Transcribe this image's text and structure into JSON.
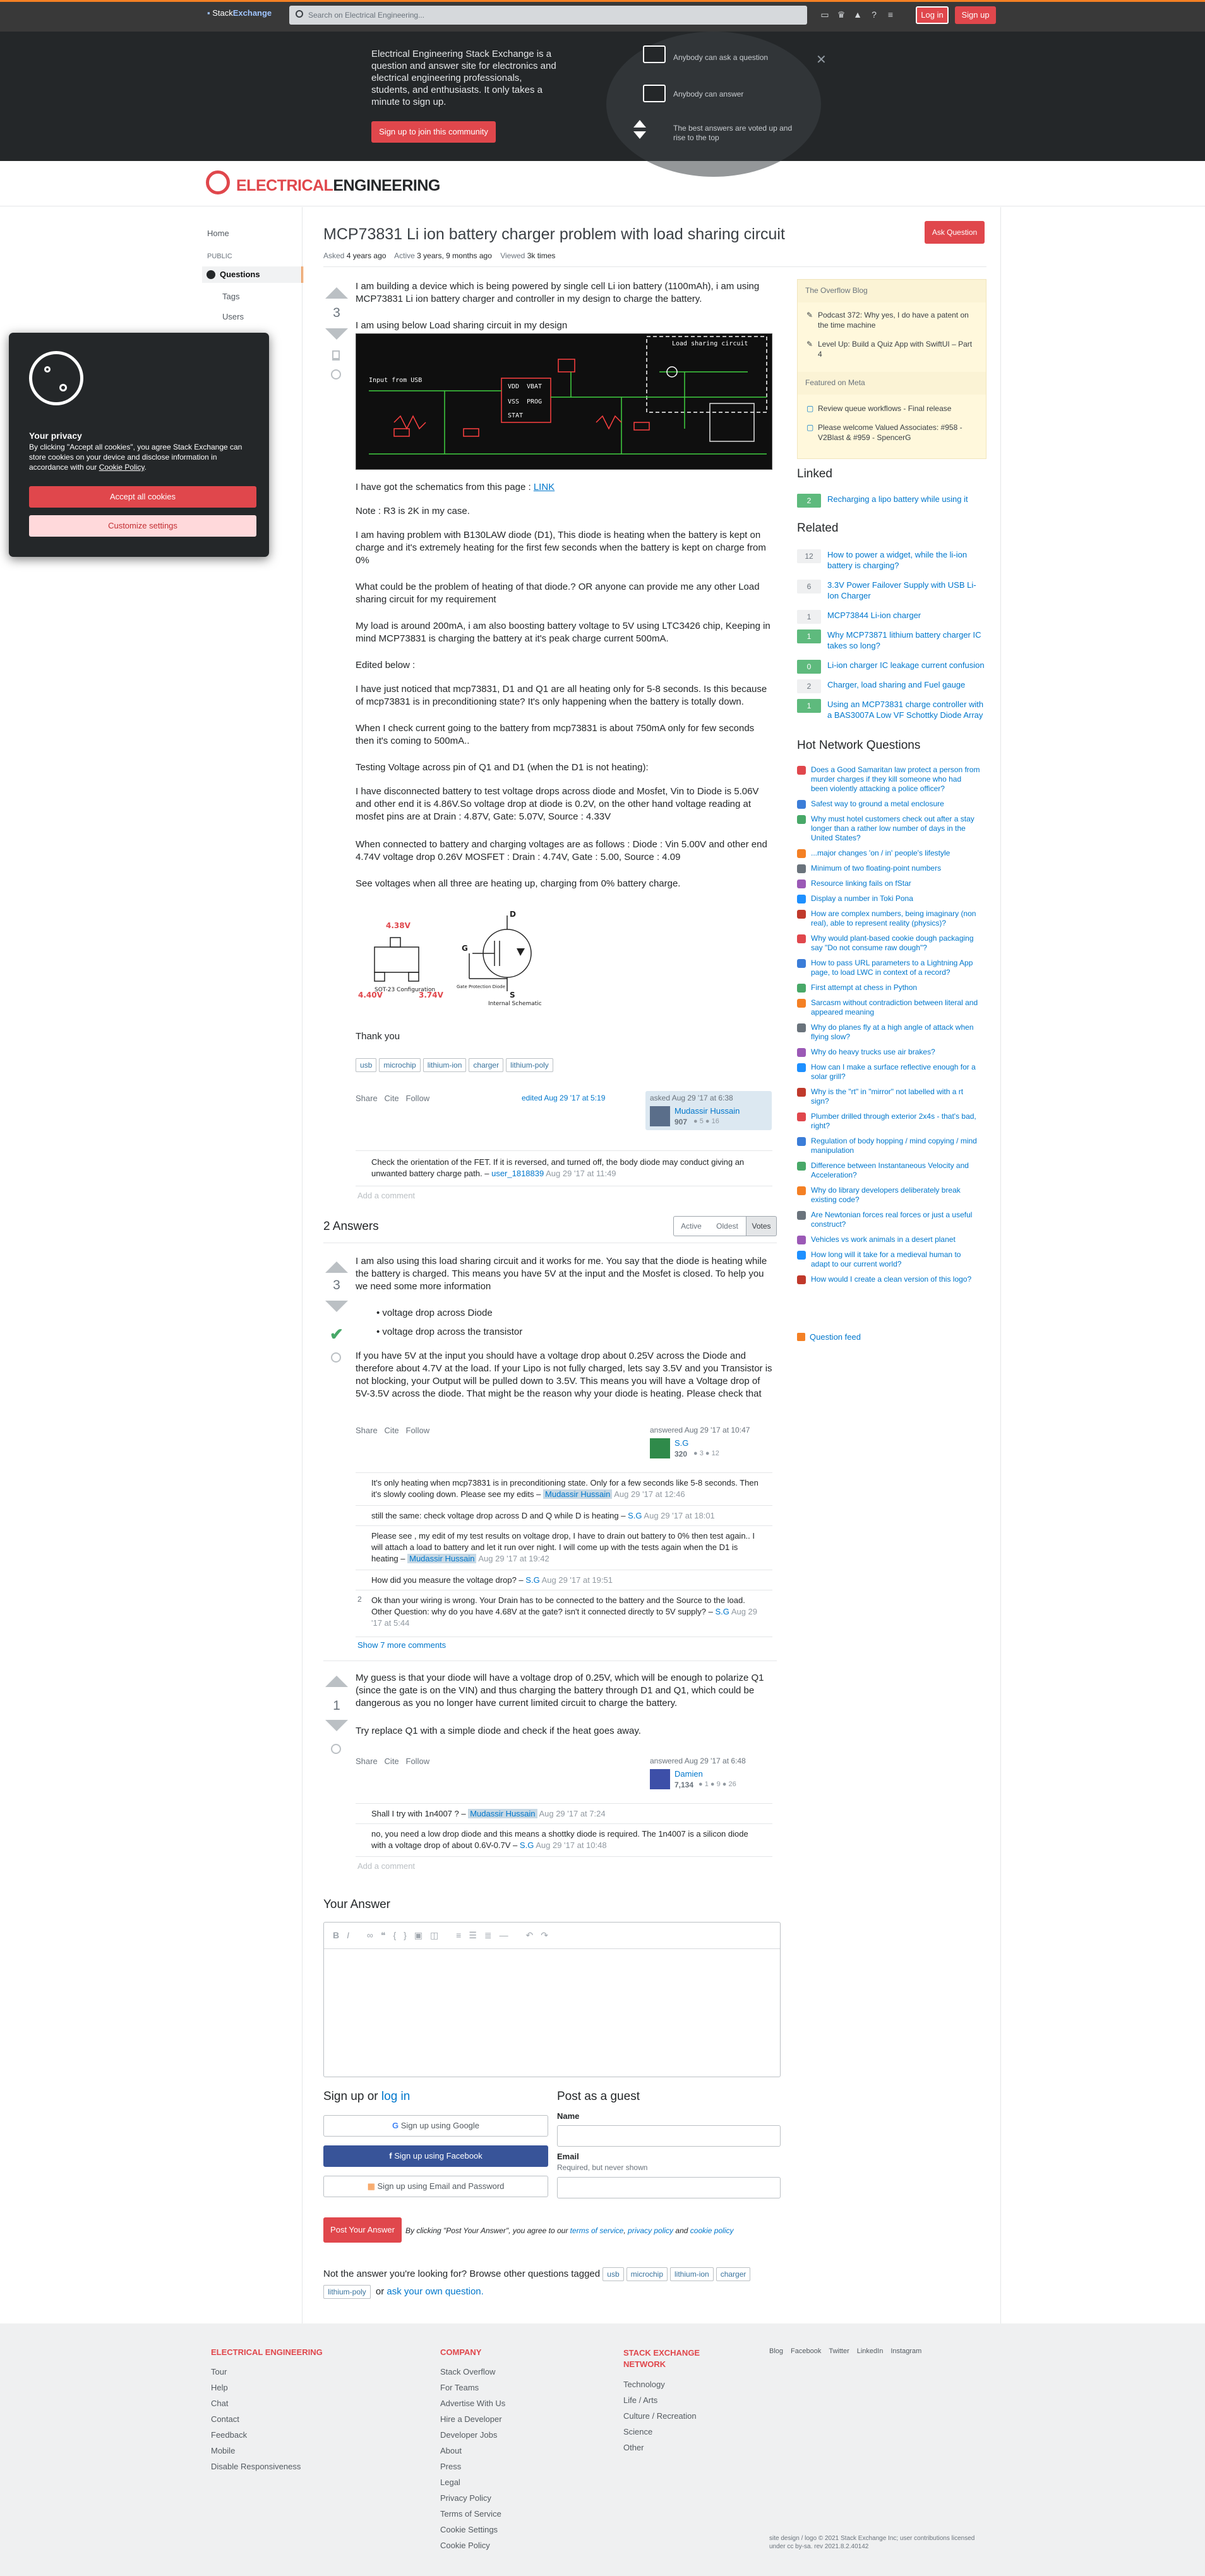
{
  "topbar": {
    "brand_a": "Stack",
    "brand_b": "Exchange",
    "search_placeholder": "Search on Electrical Engineering...",
    "login": "Log in",
    "signup": "Sign up"
  },
  "hero": {
    "text": "Electrical Engineering Stack Exchange is a question and answer site for electronics and electrical engineering professionals, students, and enthusiasts. It only takes a minute to sign up.",
    "cta": "Sign up to join this community",
    "features": [
      "Anybody can ask a question",
      "Anybody can answer",
      "The best answers are voted up and rise to the top"
    ]
  },
  "site": {
    "logo_a": "ELECTRICAL",
    "logo_b": "ENGINEERING"
  },
  "nav": {
    "home": "Home",
    "public": "PUBLIC",
    "questions": "Questions",
    "tags": "Tags",
    "users": "Users"
  },
  "question": {
    "title": "MCP73831 Li ion battery charger problem with load sharing circuit",
    "ask_button": "Ask Question",
    "asked_label": "Asked",
    "asked": "4 years ago",
    "active_label": "Active",
    "active": "3 years, 9 months ago",
    "viewed_label": "Viewed",
    "viewed": "3k times",
    "votes": "3",
    "p1": "I am building a device which is being powered by single cell Li ion battery (1100mAh), i am using MCP73831 Li ion battery charger and controller in my design to charge the battery.",
    "p2": "I am using below Load sharing circuit in my design",
    "p3a": "I have got the schematics from this page : ",
    "p3link": "LINK",
    "p4": "Note : R3 is 2K in my case.",
    "p5": "I am having problem with B130LAW diode (D1), This diode is heating when the battery is kept on charge and it's extremely heating for the first few seconds when the battery is kept on charge from 0%",
    "p6": "What could be the problem of heating of that diode.? OR anyone can provide me any other Load sharing circuit for my requirement",
    "p7": "My load is around 200mA, i am also boosting battery voltage to 5V using LTC3426 chip, Keeping in mind MCP73831 is charging the battery at it's peak charge current 500mA.",
    "p8": "Edited below :",
    "p9": "I have just noticed that mcp73831, D1 and Q1 are all heating only for 5-8 seconds. Is this because of mcp73831 is in preconditioning state? It's only happening when the battery is totally down.",
    "p10": "When I check current going to the battery from mcp73831 is about 750mA only for few seconds then it's coming to 500mA..",
    "p11": "Testing Voltage across pin of Q1 and D1 (when the D1 is not heating):",
    "p12": "I have disconnected battery to test voltage drops across diode and Mosfet, Vin to Diode is 5.06V and other end it is 4.86V.So voltage drop at diode is 0.2V, on the other hand voltage reading at mosfet pins are at Drain : 4.87V, Gate: 5.07V, Source : 4.33V",
    "p13": "When connected to battery and charging voltages are as follows : Diode : Vin 5.00V and other end 4.74V voltage drop 0.26V MOSFET : Drain : 4.74V, Gate : 5.00, Source : 4.09",
    "p14": "See voltages when all three are heating up, charging from 0% battery charge.",
    "p15": "Thank you",
    "tags": [
      "usb",
      "microchip",
      "lithium-ion",
      "charger",
      "lithium-poly"
    ],
    "share": "Share",
    "cite": "Cite",
    "follow": "Follow",
    "edited": "edited Aug 29 '17 at 5:19",
    "asked_full": "asked Aug 29 '17 at 6:38",
    "author": "Mudassir Hussain",
    "author_rep": "907",
    "author_badges": "● 5 ● 16",
    "comment": "Check the orientation of the FET. If it is reversed, and turned off, the body diode may conduct giving an unwanted battery charge path.",
    "comment_user": "user_1818839",
    "comment_date": "Aug 29 '17 at 11:49",
    "add_comment": "Add a comment"
  },
  "schematic": {
    "title": "Load sharing circuit",
    "input": "Input from USB",
    "pins": [
      "VDD",
      "VBAT",
      "VSS",
      "PROG",
      "STAT"
    ],
    "labels": [
      "D",
      "G",
      "S"
    ],
    "fet_labels": [
      "4.38V",
      "4.40V",
      "3.74V",
      "SOT-23 Configuration",
      "Internal Schematic",
      "Gate Protection Diode"
    ]
  },
  "answers": {
    "heading": "2 Answers",
    "sort": [
      "Active",
      "Oldest",
      "Votes"
    ],
    "a1": {
      "votes": "3",
      "p1": "I am also using this load sharing circuit and it works for me. You say that the diode is heating while the battery is charged. This means you have 5V at the input and the Mosfet is closed. To help you we need some more information",
      "bullets": [
        "voltage drop across Diode",
        "voltage drop across the transistor"
      ],
      "p2": "If you have 5V at the input you should have a voltage drop about 0.25V across the Diode and therefore about 4.7V at the load. If your Lipo is not fully charged, lets say 3.5V and you Transistor is not blocking, your Output will be pulled down to 3.5V. This means you will have a Voltage drop of 5V-3.5V across the diode. That might be the reason why your diode is heating. Please check that",
      "answered": "answered Aug 29 '17 at 10:47",
      "author": "S.G",
      "rep": "320",
      "badges": "● 3 ● 12",
      "comments": [
        {
          "text": "It's only heating when mcp73831 is in preconditioning state. Only for a few seconds like 5-8 seconds. Then it's slowly cooling down. Please see my edits –",
          "user": "Mudassir Hussain",
          "date": "Aug 29 '17 at 12:46"
        },
        {
          "text": "still the same: check voltage drop across D and Q while D is heating –",
          "user": "S.G",
          "date": "Aug 29 '17 at 18:01"
        },
        {
          "text": "Please see , my edit of my test results on voltage drop, I have to drain out battery to 0% then test again.. I will attach a load to battery and let it run over night. I will come up with the tests again when the D1 is heating –",
          "user": "Mudassir Hussain",
          "date": "Aug 29 '17 at 19:42"
        },
        {
          "text": "How did you measure the voltage drop? –",
          "user": "S.G",
          "date": "Aug 29 '17 at 19:51"
        },
        {
          "text": "Ok than your wiring is wrong. Your Drain has to be connected to the battery and the Source to the load. Other Question: why do you have 4.68V at the gate? isn't it connected directly to 5V supply? –",
          "user": "S.G",
          "date": "Aug 29 '17 at 5:44",
          "votes": "2"
        }
      ],
      "show_more": "Show 7 more comments"
    },
    "a2": {
      "votes": "1",
      "p1": "My guess is that your diode will have a voltage drop of 0.25V, which will be enough to polarize Q1 (since the gate is on the VIN) and thus charging the battery through D1 and Q1, which could be dangerous as you no longer have current limited circuit to charge the battery.",
      "p2": "Try replace Q1 with a simple diode and check if the heat goes away.",
      "answered": "answered Aug 29 '17 at 6:48",
      "author": "Damien",
      "rep": "7,134",
      "badges": "● 1 ● 9 ● 26",
      "comments": [
        {
          "text": "Shall I try with 1n4007 ? –",
          "user": "Mudassir Hussain",
          "date": "Aug 29 '17 at 7:24"
        },
        {
          "text": "no, you need a low drop diode and this means a shottky diode is required. The 1n4007 is a silicon diode with a voltage drop of about 0.6V-0.7V –",
          "user": "S.G",
          "date": "Aug 29 '17 at 10:48"
        }
      ],
      "add_comment": "Add a comment"
    }
  },
  "your_answer": {
    "heading": "Your Answer",
    "signup_heading": "Sign up or",
    "login_link": "log in",
    "google": "Sign up using Google",
    "facebook": "Sign up using Facebook",
    "email": "Sign up using Email and Password",
    "guest_heading": "Post as a guest",
    "name_label": "Name",
    "email_label": "Email",
    "email_hint": "Required, but never shown",
    "post_button": "Post Your Answer",
    "terms_prefix": "By clicking \"Post Your Answer\", you agree to our",
    "terms": "terms of service",
    "privacy": "privacy policy",
    "and": "and",
    "cookie": "cookie policy",
    "not_answer": "Not the answer you're looking for? Browse other questions tagged",
    "or": "or",
    "ask_own": "ask your own question."
  },
  "sidebar": {
    "blog_heading": "The Overflow Blog",
    "blog": [
      "Podcast 372: Why yes, I do have a patent on the time machine",
      "Level Up: Build a Quiz App with SwiftUI – Part 4"
    ],
    "meta_heading": "Featured on Meta",
    "meta": [
      "Review queue workflows - Final release",
      "Please welcome Valued Associates: #958 - V2Blast & #959 - SpencerG"
    ],
    "linked_heading": "Linked",
    "linked": [
      {
        "n": "2",
        "t": "Recharging a lipo battery while using it",
        "g": true
      }
    ],
    "related_heading": "Related",
    "related": [
      {
        "n": "12",
        "t": "How to power a widget, while the li-ion battery is charging?",
        "g": false
      },
      {
        "n": "6",
        "t": "3.3V Power Failover Supply with USB Li-Ion Charger",
        "g": false
      },
      {
        "n": "1",
        "t": "MCP73844 Li-ion charger",
        "g": false
      },
      {
        "n": "1",
        "t": "Why MCP73871 lithium battery charger IC takes so long?",
        "g": true
      },
      {
        "n": "0",
        "t": "Li-ion charger IC leakage current confusion",
        "g": true
      },
      {
        "n": "2",
        "t": "Charger, load sharing and Fuel gauge",
        "g": false
      },
      {
        "n": "1",
        "t": "Using an MCP73831 charge controller with a BAS3007A Low VF Schottky Diode Array",
        "g": true
      }
    ],
    "hnq_heading": "Hot Network Questions",
    "hnq": [
      "Does a Good Samaritan law protect a person from murder charges if they kill someone who had been violently attacking a police officer?",
      "Safest way to ground a metal enclosure",
      "Why must hotel customers check out after a stay longer than a rather low number of days in the United States?",
      "...major changes 'on / in' people's lifestyle",
      "Minimum of two floating-point numbers",
      "Resource linking fails on fStar",
      "Display a number in Toki Pona",
      "How are complex numbers, being imaginary (non real), able to represent reality (physics)?",
      "Why would plant-based cookie dough packaging say \"Do not consume raw dough\"?",
      "How to pass URL parameters to a Lightning App page, to load LWC in context of a record?",
      "First attempt at chess in Python",
      "Sarcasm without contradiction between literal and appeared meaning",
      "Why do planes fly at a high angle of attack when flying slow?",
      "Why do heavy trucks use air brakes?",
      "How can I make a surface reflective enough for a solar grill?",
      "Why is the \"rt\" in \"mirror\" not labelled with a rt sign?",
      "Plumber drilled through exterior 2x4s - that's bad, right?",
      "Regulation of body hopping / mind copying / mind manipulation",
      "Difference between Instantaneous Velocity and Acceleration?",
      "Why do library developers deliberately break existing code?",
      "Are Newtonian forces real forces or just a useful construct?",
      "Vehicles vs work animals in a desert planet",
      "How long will it take for a medieval human to adapt to our current world?",
      "How would I create a clean version of this logo?"
    ],
    "feed": "Question feed"
  },
  "cookie": {
    "title": "Your privacy",
    "text": "By clicking \"Accept all cookies\", you agree Stack Exchange can store cookies on your device and disclose information in accordance with our",
    "policy": "Cookie Policy",
    "accept": "Accept all cookies",
    "customize": "Customize settings"
  },
  "footer": {
    "col1_head": "ELECTRICAL ENGINEERING",
    "col1": [
      "Tour",
      "Help",
      "Chat",
      "Contact",
      "Feedback",
      "Mobile",
      "Disable Responsiveness"
    ],
    "col2_head": "COMPANY",
    "col2": [
      "Stack Overflow",
      "For Teams",
      "Advertise With Us",
      "Hire a Developer",
      "Developer Jobs",
      "About",
      "Press",
      "Legal",
      "Privacy Policy",
      "Terms of Service",
      "Cookie Settings",
      "Cookie Policy"
    ],
    "col3_head": "STACK EXCHANGE NETWORK",
    "col3": [
      "Technology",
      "Life / Arts",
      "Culture / Recreation",
      "Science",
      "Other"
    ],
    "social": [
      "Blog",
      "Facebook",
      "Twitter",
      "LinkedIn",
      "Instagram"
    ],
    "copyright": "site design / logo © 2021 Stack Exchange Inc; user contributions licensed under cc by-sa. rev 2021.8.2.40142"
  },
  "colors": {
    "brand": "#e0474c",
    "accent": "#f48024",
    "link": "#0077cc"
  }
}
